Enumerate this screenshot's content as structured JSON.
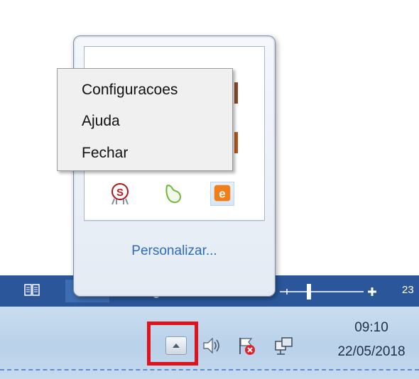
{
  "context_menu": {
    "items": [
      {
        "label": "Configuracoes"
      },
      {
        "label": "Ajuda"
      },
      {
        "label": "Fechar"
      }
    ]
  },
  "tray_popup": {
    "customize_link": "Personalizar...",
    "icons": [
      "red-s-medal-icon",
      "green-leaf-icon",
      "orange-e-icon"
    ]
  },
  "statusbar": {
    "zoom_text": "23"
  },
  "taskbar": {
    "clock": {
      "time": "09:10",
      "date": "22/05/2018"
    },
    "tray_icons": [
      "show-hidden-icons",
      "volume-icon",
      "action-center-flag-icon",
      "network-icon"
    ],
    "highlight_color": "#e0121c"
  },
  "colors": {
    "statusbar_bg": "#2b579a",
    "taskbar_bg": "#b9d1ea",
    "link": "#2b6cc4",
    "menu_bg": "#f0f0f0"
  }
}
